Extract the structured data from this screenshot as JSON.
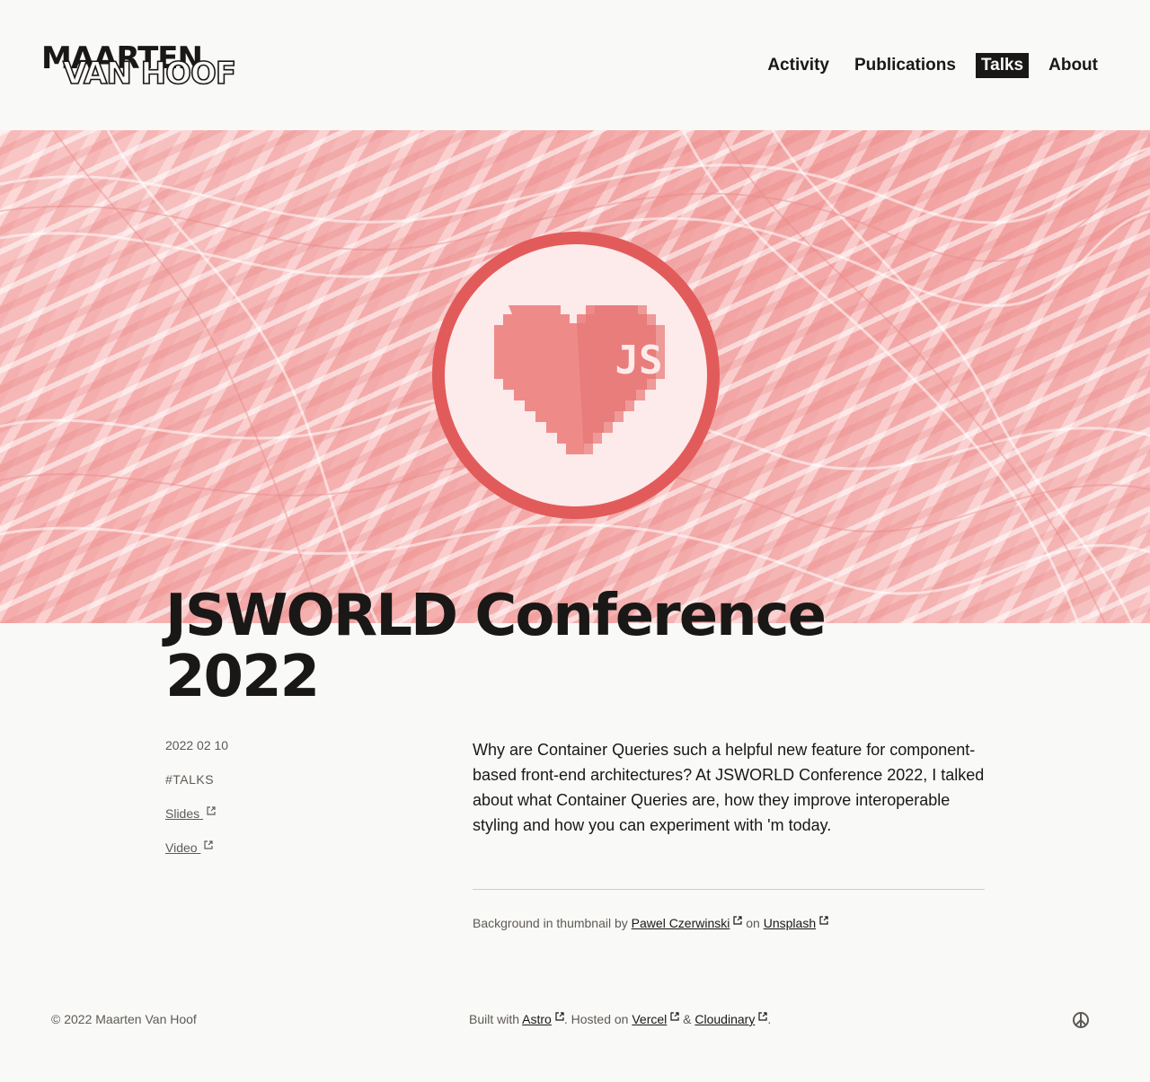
{
  "header": {
    "logo_line1": "MAARTEN",
    "logo_line2": "VAN HOOF",
    "nav": [
      {
        "label": "Activity",
        "active": false
      },
      {
        "label": "Publications",
        "active": false
      },
      {
        "label": "Talks",
        "active": true
      },
      {
        "label": "About",
        "active": false
      }
    ]
  },
  "hero": {
    "badge_text": "JS",
    "colors": {
      "ring": "#e25b5b",
      "heart": "#ee8b89",
      "heart_dark": "#e67775",
      "circle_fill": "#fdeaea"
    }
  },
  "post": {
    "title_line1": "JSWORLD Conference",
    "title_line2": "2022",
    "date": "2022 02 10",
    "tag": "#TALKS",
    "slides_label": "Slides",
    "video_label": "Video",
    "description": "Why are Container Queries such a helpful new feature for component-based front-end architectures? At JSWORLD Conference 2022, I talked about what Container Queries are, how they improve interoperable styling and how you can experiment with 'm today.",
    "credit": {
      "prefix": "Background in thumbnail by",
      "author": "Pawel Czerwinski",
      "middle": "on",
      "source": "Unsplash"
    }
  },
  "footer": {
    "copyright": "© 2022 Maarten Van Hoof",
    "built_prefix": "Built with",
    "astro": "Astro",
    "hosted": ". Hosted on",
    "vercel": "Vercel",
    "amp": "&",
    "cloudinary": "Cloudinary",
    "end": ".",
    "peace_icon": "peace-icon"
  }
}
